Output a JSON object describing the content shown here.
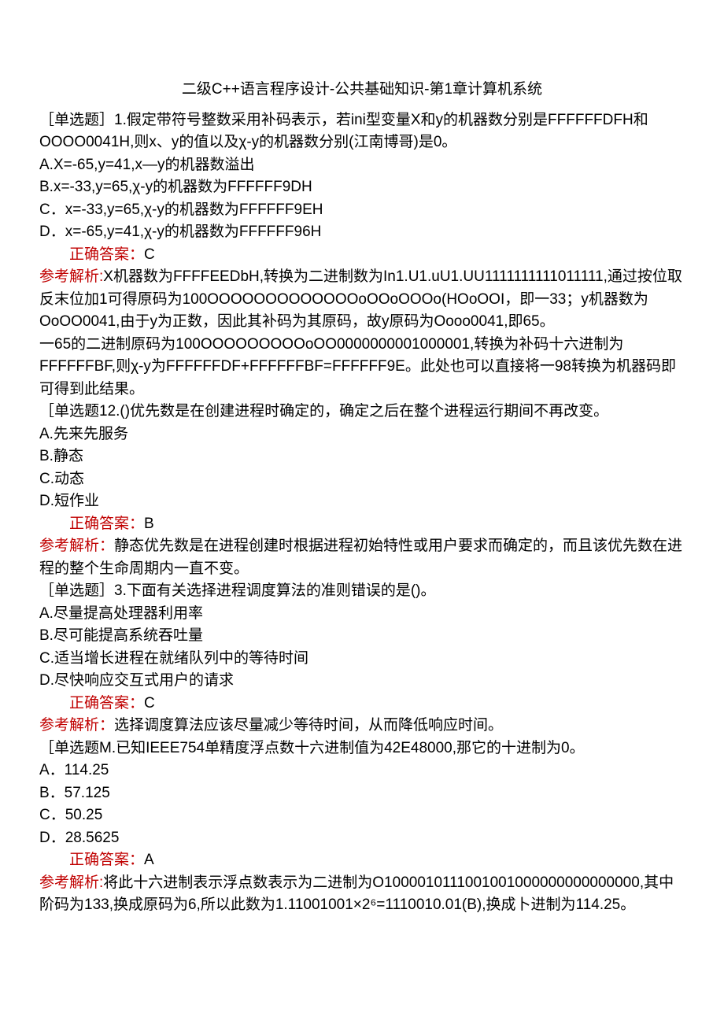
{
  "title": "二级C++语言程序设计-公共基础知识-第1章计算机系统",
  "q1": {
    "stem": "［单选题］1.假定带符号整数采用补码表示，若ini型变量X和y的机器数分别是FFFFFFDFH和OOOO0041H,则x、y的值以及χ-y的机器数分别(江南博哥)是0。",
    "a": "A.X=-65,y=41,x—y的机器数溢出",
    "b": "B.x=-33,y=65,χ-y的机器数为FFFFFF9DH",
    "c": "C．x=-33,y=65,χ-y的机器数为FFFFFF9EH",
    "d": "D．x=-65,y=41,χ-y的机器数为FFFFFF96H",
    "ans_label": "正确答案：",
    "ans": "C",
    "exp_label": "参考解析:",
    "exp1": "X机器数为FFFFEEDbH,转换为二进制数为In1.U1.uU1.UU1111111111011111,通过按位取反末位加1可得原码为100OOOOOOOOOOOOOoOOoOOOo(HOoOOI，即一33；y机器数为OoOO0041,由于y为正数，因此其补码为其原码，故y原码为Oooo0041,即65。",
    "exp2": "一65的二进制原码为100OOOOOOOOOoOO0000000001000001,转换为补码十六进制为FFFFFFBF,则χ-y为FFFFFFDF+FFFFFFBF=FFFFFF9E。此处也可以直接将一98转换为机器码即可得到此结果。"
  },
  "q2": {
    "stem": "［单选题12.()优先数是在创建进程时确定的，确定之后在整个进程运行期间不再改变。",
    "a": "A.先来先服务",
    "b": "B.静态",
    "c": "C.动态",
    "d": "D.短作业",
    "ans_label": "正确答案：",
    "ans": "B",
    "exp_label": "参考解析：",
    "exp": "静态优先数是在进程创建时根据进程初始特性或用户要求而确定的，而且该优先数在进程的整个生命周期内一直不变。"
  },
  "q3": {
    "stem": "［单选题］3.下面有关选择进程调度算法的准则错误的是()。",
    "a": "A.尽量提高处理器利用率",
    "b": "B.尽可能提高系统吞吐量",
    "c": "C.适当增长进程在就绪队列中的等待时间",
    "d": "D.尽快响应交互式用户的请求",
    "ans_label": "正确答案：",
    "ans": "C",
    "exp_label": "参考解析：",
    "exp": "选择调度算法应该尽量减少等待时间，从而降低响应时间。"
  },
  "q4": {
    "stem": "［单选题M.已知IEEE754单精度浮点数十六进制值为42E48000,那它的十进制为0。",
    "a": "A．114.25",
    "b": "B．57.125",
    "c": "C．50.25",
    "d": "D．28.5625",
    "ans_label": "正确答案：",
    "ans": "A",
    "exp_label": "参考解析:",
    "exp": "将此十六进制表示浮点数表示为二进制为O1000010111001001000000000000000,其中阶码为133,换成原码为6,所以此数为1.11001001×2⁶=1110010.01(B),换成卜进制为114.25。"
  }
}
